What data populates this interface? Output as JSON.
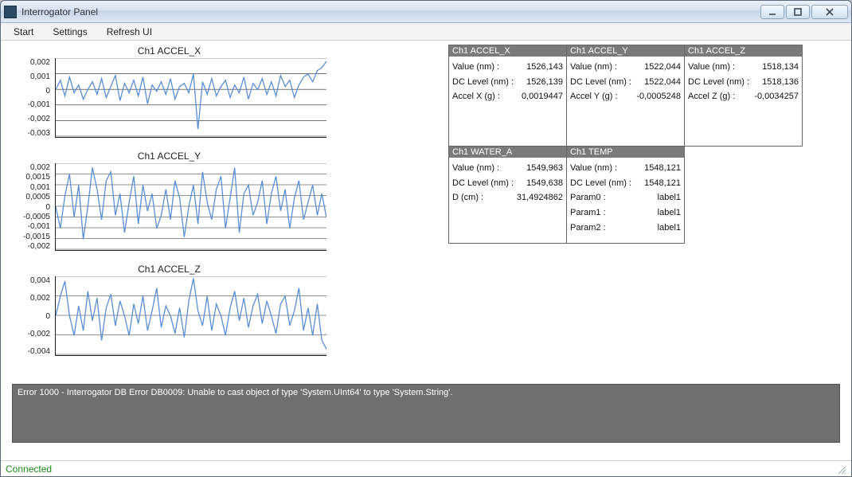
{
  "window": {
    "title": "Interrogator Panel"
  },
  "menu": {
    "start": "Start",
    "settings": "Settings",
    "refresh": "Refresh UI"
  },
  "status": {
    "text": "Connected"
  },
  "error": {
    "text": "Error 1000 - Interrogator DB Error DB0009: Unable to cast object of type 'System.UInt64' to type 'System.String'."
  },
  "panels": {
    "accel_x": {
      "title": "Ch1 ACCEL_X",
      "rows": [
        {
          "k": "Value (nm) :",
          "v": "1526,143"
        },
        {
          "k": "DC Level (nm) :",
          "v": "1526,139"
        },
        {
          "k": "Accel X (g) :",
          "v": "0,0019447"
        }
      ]
    },
    "accel_y": {
      "title": "Ch1 ACCEL_Y",
      "rows": [
        {
          "k": "Value (nm) :",
          "v": "1522,044"
        },
        {
          "k": "DC Level (nm) :",
          "v": "1522,044"
        },
        {
          "k": "Accel Y (g) :",
          "v": "-0,0005248"
        }
      ]
    },
    "accel_z": {
      "title": "Ch1 ACCEL_Z",
      "rows": [
        {
          "k": "Value (nm) :",
          "v": "1518,134"
        },
        {
          "k": "DC Level (nm) :",
          "v": "1518,136"
        },
        {
          "k": "Accel Z (g) :",
          "v": "-0,0034257"
        }
      ]
    },
    "water_a": {
      "title": "Ch1 WATER_A",
      "rows": [
        {
          "k": "Value (nm) :",
          "v": "1549,963"
        },
        {
          "k": "DC Level (nm) :",
          "v": "1549,638"
        },
        {
          "k": "D (cm) :",
          "v": "31,4924862"
        }
      ]
    },
    "temp": {
      "title": "Ch1 TEMP",
      "rows": [
        {
          "k": "Value (nm) :",
          "v": "1548,121"
        },
        {
          "k": "DC Level (nm) :",
          "v": "1548,121"
        },
        {
          "k": "Param0 :",
          "v": "label1"
        },
        {
          "k": "Param1 :",
          "v": "label1"
        },
        {
          "k": "Param2 :",
          "v": "label1"
        }
      ]
    }
  },
  "chart_data": [
    {
      "type": "line",
      "title": "Ch1 ACCEL_X",
      "ylim": [
        -0.003,
        0.002
      ],
      "yticks": [
        "0,002",
        "0,001",
        "0",
        "-0,001",
        "-0,002",
        "-0,003"
      ],
      "x": [
        0,
        1,
        2,
        3,
        4,
        5,
        6,
        7,
        8,
        9,
        10,
        11,
        12,
        13,
        14,
        15,
        16,
        17,
        18,
        19,
        20,
        21,
        22,
        23,
        24,
        25,
        26,
        27,
        28,
        29,
        30,
        31,
        32,
        33,
        34,
        35,
        36,
        37,
        38,
        39,
        40,
        41,
        42,
        43,
        44,
        45,
        46,
        47,
        48,
        49,
        50,
        51,
        52,
        53,
        54,
        55,
        56,
        57,
        58,
        59
      ],
      "values": [
        0.0,
        0.0006,
        -0.0004,
        0.0008,
        -0.0002,
        0.0003,
        -0.0006,
        0.0,
        0.0005,
        -0.0003,
        0.0007,
        -0.0005,
        0.0002,
        0.0009,
        -0.0007,
        0.0004,
        -0.0002,
        0.0006,
        -0.0004,
        0.0008,
        -0.0009,
        0.0003,
        -0.0001,
        0.0005,
        -0.0003,
        0.0007,
        -0.0006,
        0.0002,
        0.0004,
        -0.0002,
        0.001,
        -0.0025,
        0.0005,
        -0.0003,
        0.0007,
        -0.0004,
        0.0002,
        0.0006,
        -0.0005,
        0.0003,
        -0.0002,
        0.0008,
        -0.0006,
        0.0004,
        0.0,
        0.0007,
        -0.0003,
        0.0005,
        -0.0004,
        0.0009,
        0.0002,
        0.0006,
        -0.0005,
        0.0003,
        0.0008,
        0.001,
        0.0005,
        0.0012,
        0.0014,
        0.0018
      ]
    },
    {
      "type": "line",
      "title": "Ch1 ACCEL_Y",
      "ylim": [
        -0.002,
        0.002
      ],
      "yticks": [
        "0,002",
        "0,0015",
        "0,001",
        "0,0005",
        "0",
        "-0,0005",
        "-0,001",
        "-0,0015",
        "-0,002"
      ],
      "x": [
        0,
        1,
        2,
        3,
        4,
        5,
        6,
        7,
        8,
        9,
        10,
        11,
        12,
        13,
        14,
        15,
        16,
        17,
        18,
        19,
        20,
        21,
        22,
        23,
        24,
        25,
        26,
        27,
        28,
        29,
        30,
        31,
        32,
        33,
        34,
        35,
        36,
        37,
        38,
        39,
        40,
        41,
        42,
        43,
        44,
        45,
        46,
        47,
        48,
        49,
        50,
        51,
        52,
        53,
        54,
        55,
        56,
        57,
        58,
        59
      ],
      "values": [
        0.0,
        -0.001,
        0.0005,
        0.0015,
        -0.0005,
        0.001,
        -0.0015,
        0.0,
        0.0018,
        0.0008,
        -0.0006,
        0.0012,
        0.0016,
        -0.0004,
        0.0006,
        -0.0012,
        0.0002,
        0.0014,
        -0.0008,
        0.001,
        -0.0002,
        0.0006,
        -0.001,
        -0.0004,
        0.0008,
        -0.0006,
        0.0012,
        0.0004,
        -0.0014,
        0.0,
        0.001,
        -0.0008,
        0.0016,
        0.0002,
        -0.0006,
        0.0008,
        0.0014,
        -0.001,
        0.0004,
        0.0018,
        -0.0012,
        0.0006,
        0.001,
        -0.0004,
        0.0002,
        0.0012,
        -0.0008,
        0.0006,
        0.0014,
        -0.0002,
        0.0008,
        -0.001,
        0.0004,
        0.0012,
        -0.0006,
        0.0002,
        0.001,
        -0.0004,
        0.0006,
        -0.0005
      ]
    },
    {
      "type": "line",
      "title": "Ch1 ACCEL_Z",
      "ylim": [
        -0.004,
        0.004
      ],
      "yticks": [
        "0,004",
        "0,002",
        "0",
        "-0,002",
        "-0,004"
      ],
      "x": [
        0,
        1,
        2,
        3,
        4,
        5,
        6,
        7,
        8,
        9,
        10,
        11,
        12,
        13,
        14,
        15,
        16,
        17,
        18,
        19,
        20,
        21,
        22,
        23,
        24,
        25,
        26,
        27,
        28,
        29,
        30,
        31,
        32,
        33,
        34,
        35,
        36,
        37,
        38,
        39,
        40,
        41,
        42,
        43,
        44,
        45,
        46,
        47,
        48,
        49,
        50,
        51,
        52,
        53,
        54,
        55,
        56,
        57,
        58,
        59
      ],
      "values": [
        0.0,
        0.002,
        0.0035,
        0.0,
        -0.002,
        0.001,
        -0.0015,
        0.0025,
        -0.0005,
        0.0018,
        -0.0025,
        0.0008,
        0.0022,
        -0.001,
        0.0015,
        0.0,
        -0.002,
        0.0012,
        -0.0008,
        0.002,
        -0.0015,
        0.0005,
        0.0028,
        -0.0012,
        0.001,
        0.0,
        -0.0018,
        0.0008,
        -0.0022,
        0.0015,
        0.0038,
        0.0005,
        -0.001,
        0.002,
        -0.0015,
        0.0012,
        0.0,
        -0.002,
        0.0008,
        0.0025,
        -0.0005,
        0.0018,
        -0.0012,
        0.001,
        0.0022,
        -0.0008,
        0.0015,
        0.0,
        -0.0018,
        0.0012,
        0.002,
        -0.001,
        0.0005,
        0.0028,
        -0.0015,
        0.0008,
        -0.002,
        0.0012,
        -0.0025,
        -0.0034
      ]
    }
  ]
}
